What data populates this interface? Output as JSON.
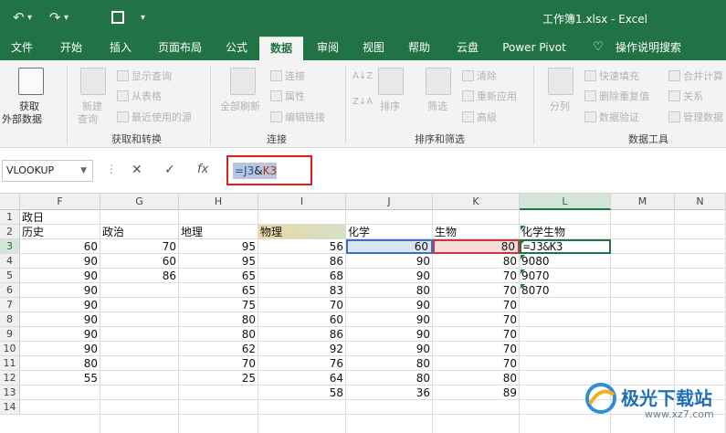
{
  "window": {
    "title": "工作簿1.xlsx  -  Excel",
    "qa_icons": [
      "undo-icon",
      "redo-icon",
      "save-icon",
      "customize-icon"
    ]
  },
  "tabs": [
    {
      "label": "文件"
    },
    {
      "label": "开始"
    },
    {
      "label": "插入"
    },
    {
      "label": "页面布局"
    },
    {
      "label": "公式"
    },
    {
      "label": "数据"
    },
    {
      "label": "审阅"
    },
    {
      "label": "视图"
    },
    {
      "label": "帮助"
    },
    {
      "label": "云盘"
    },
    {
      "label": "Power Pivot"
    },
    {
      "label": "操作说明搜索"
    }
  ],
  "ribbon": {
    "get_data": {
      "line1": "获取",
      "line2": "外部数据"
    },
    "get_transform": {
      "new_query_1": "新建",
      "new_query_2": "查询",
      "show_queries": "显示查询",
      "from_table": "从表格",
      "recent_sources": "最近使用的源",
      "group": "获取和转换"
    },
    "connections": {
      "refresh_1": "全部刷新",
      "connections": "连接",
      "properties": "属性",
      "edit_links": "编辑链接",
      "group": "连接"
    },
    "sort_filter": {
      "sort": "排序",
      "filter": "筛选",
      "clear": "清除",
      "reapply": "重新应用",
      "advanced": "高级",
      "group": "排序和筛选"
    },
    "data_tools": {
      "text_to_columns": "分列",
      "flash_fill": "快速填充",
      "remove_duplicates": "删除重复值",
      "data_validation": "数据验证",
      "consolidate": "合并计算",
      "relationships": "关系",
      "manage_model": "管理数据",
      "group": "数据工具"
    }
  },
  "formula_bar": {
    "name_box": "VLOOKUP",
    "formula_part1": "=J3",
    "formula_part2": "&",
    "formula_part3": "K3"
  },
  "columns": [
    "F",
    "G",
    "H",
    "I",
    "J",
    "K",
    "L",
    "M",
    "N"
  ],
  "rows": [
    "1",
    "2",
    "3",
    "4",
    "5",
    "6",
    "7",
    "8",
    "9",
    "10",
    "11",
    "12",
    "13",
    "14"
  ],
  "headers": {
    "a1": "政日",
    "history": "历史",
    "politics": "政治",
    "geography": "地理",
    "physics": "物理",
    "chemistry": "化学",
    "biology": "生物",
    "chem_bio": "化学生物"
  },
  "data": {
    "F": [
      "60",
      "90",
      "90",
      "90",
      "90",
      "90",
      "90",
      "90",
      "80",
      "55"
    ],
    "G": [
      "70",
      "60",
      "86"
    ],
    "H": [
      "95",
      "95",
      "65",
      "65",
      "75",
      "80",
      "80",
      "62",
      "70",
      "25"
    ],
    "I": [
      "56",
      "86",
      "68",
      "83",
      "70",
      "60",
      "86",
      "92",
      "76",
      "64",
      "58"
    ],
    "J": [
      "60",
      "90",
      "90",
      "80",
      "90",
      "90",
      "90",
      "90",
      "80",
      "80",
      "36"
    ],
    "K": [
      "80",
      "80",
      "70",
      "70",
      "70",
      "70",
      "70",
      "70",
      "70",
      "80",
      "89"
    ],
    "L": [
      "=J3&K3",
      "9080",
      "9070",
      "8070"
    ]
  },
  "watermark": {
    "name": "极光下载站",
    "url": "www.xz7.com"
  },
  "colors": {
    "excel_green": "#217346",
    "chem_fill": "#dce6f1",
    "bio_fill": "#f8dcdc",
    "physics_fill": "#e4d3a6",
    "highlight_red": "#e02020"
  }
}
